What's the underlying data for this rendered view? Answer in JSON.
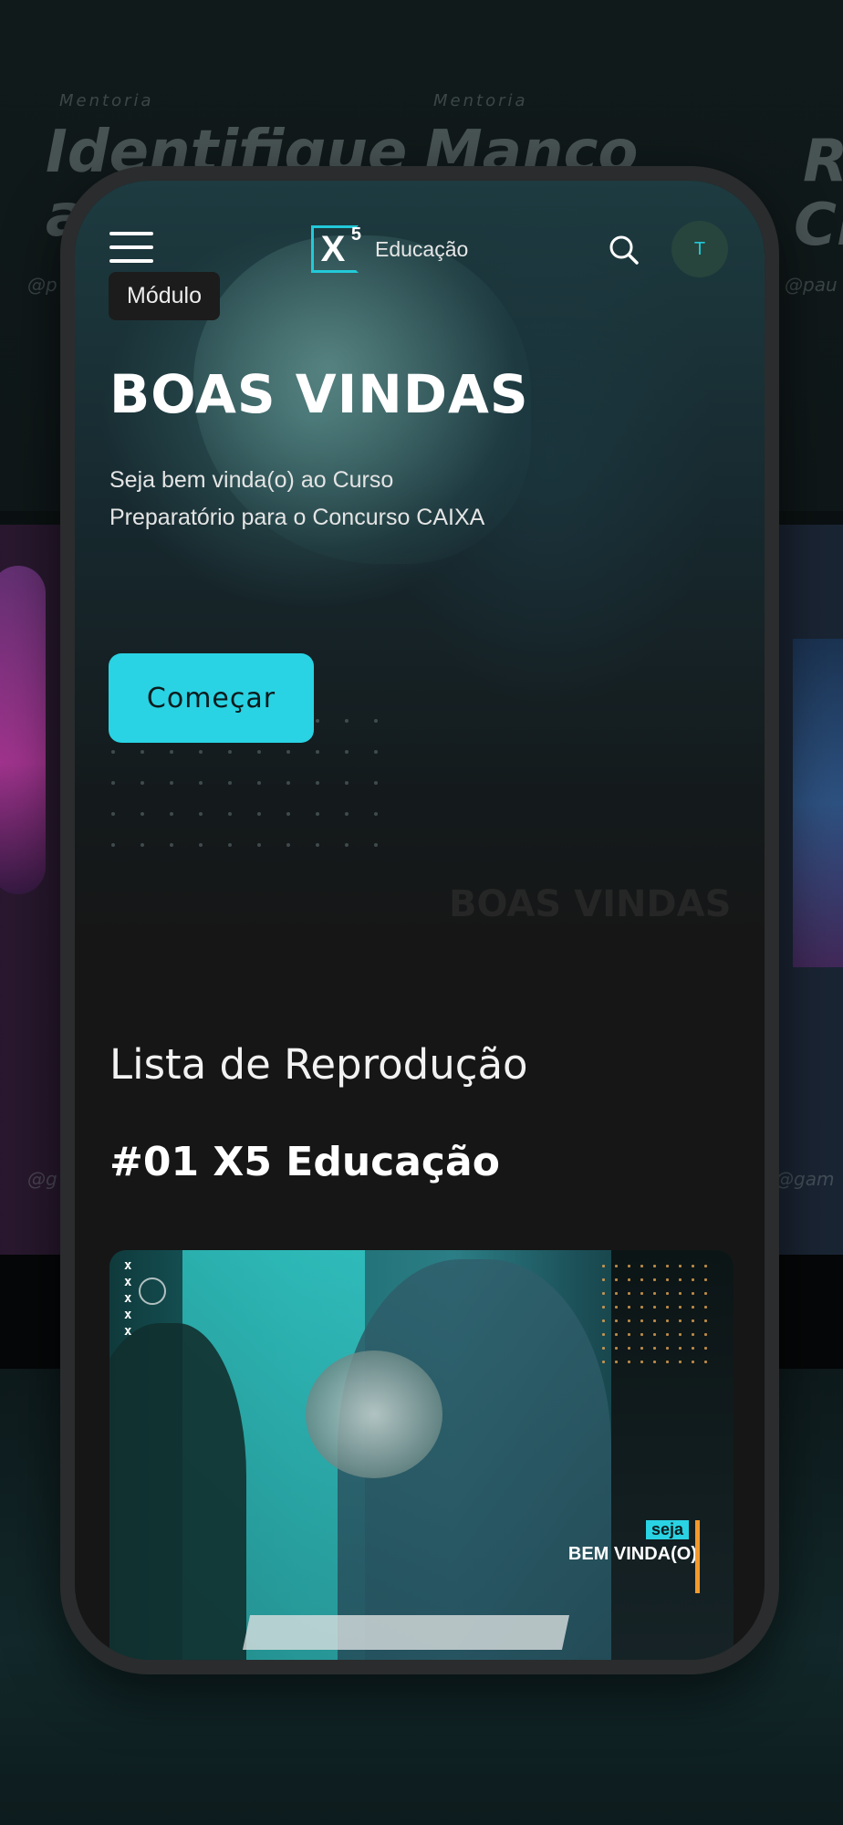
{
  "background": {
    "cards": [
      {
        "label": "Mentoria",
        "title_lines": [
          "Identifique",
          "a"
        ],
        "handle": "@p"
      },
      {
        "label": "Mentoria",
        "title_lines": [
          "Manco",
          ""
        ],
        "handle": ""
      },
      {
        "label": "",
        "title_lines": [
          "Re",
          "Cr"
        ],
        "handle": "@pau"
      }
    ],
    "handles_mid": [
      "@g",
      "@gam"
    ]
  },
  "header": {
    "menu_icon": "hamburger-menu-icon",
    "logo_mark": "X",
    "logo_sup": "5",
    "logo_text": "Educação",
    "search_icon": "search-icon",
    "avatar_initial": "T"
  },
  "hero": {
    "chip": "Módulo",
    "title": "BOAS VINDAS",
    "subtitle": "Seja bem vinda(o) ao Curso Preparatório para o Concurso CAIXA",
    "cta": "Começar",
    "watermark": "BOAS VINDAS"
  },
  "playlist": {
    "heading": "Lista de Reprodução",
    "item_title": "#01 X5 Educação",
    "thumb_marks": "x\nx\nx\nx\nx",
    "thumb_badge_small": "seja",
    "thumb_badge_big": "BEM VINDA(O)"
  },
  "colors": {
    "accent": "#29d3e3",
    "orange": "#f39a2c",
    "screen_bg": "#161616"
  }
}
